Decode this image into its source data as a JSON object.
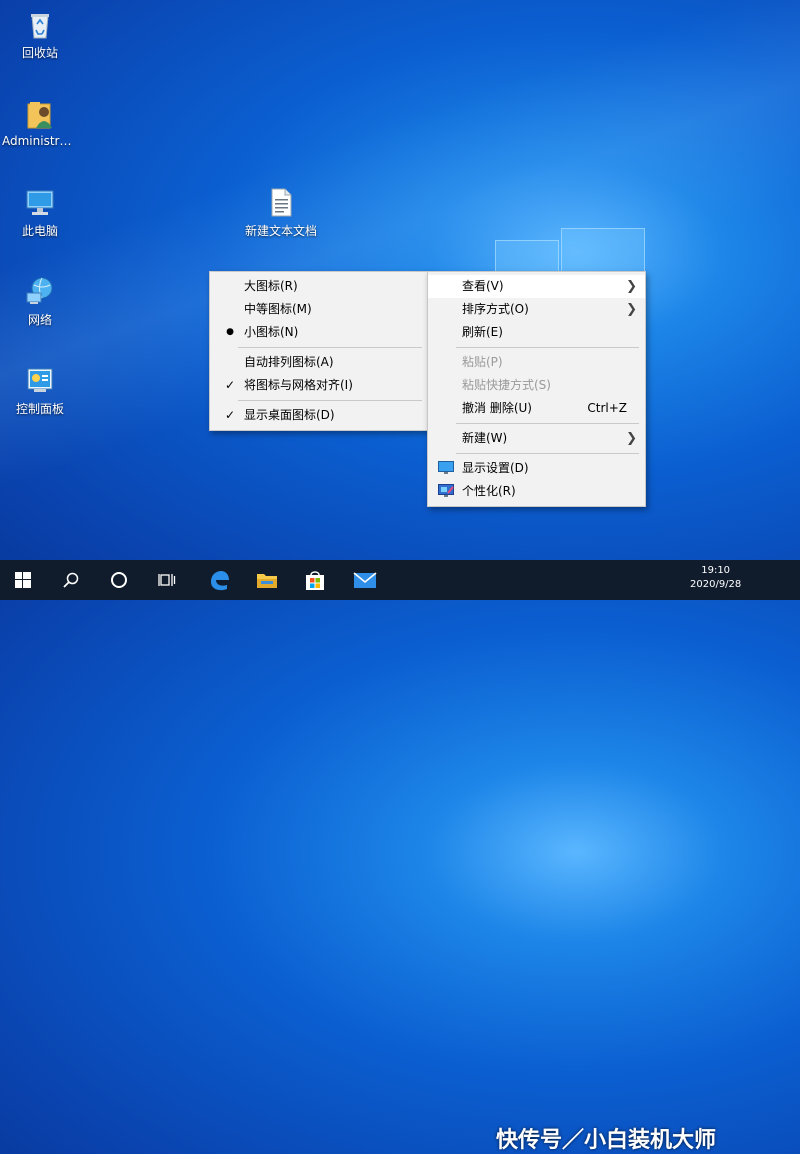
{
  "desktop": {
    "icons": [
      {
        "label": "回收站"
      },
      {
        "label": "Administra..."
      },
      {
        "label": "此电脑"
      },
      {
        "label": "网络"
      },
      {
        "label": "控制面板"
      },
      {
        "label": "新建文本文档"
      }
    ]
  },
  "context_menu": {
    "items": [
      {
        "label": "查看(V)"
      },
      {
        "label": "排序方式(O)"
      },
      {
        "label": "刷新(E)"
      },
      {
        "label": "粘贴(P)"
      },
      {
        "label": "粘贴快捷方式(S)"
      },
      {
        "label": "撤消 删除(U)",
        "shortcut": "Ctrl+Z"
      },
      {
        "label": "新建(W)"
      },
      {
        "label": "显示设置(D)"
      },
      {
        "label": "个性化(R)"
      }
    ]
  },
  "view_submenu": {
    "items": [
      {
        "label": "大图标(R)"
      },
      {
        "label": "中等图标(M)"
      },
      {
        "label": "小图标(N)",
        "mark": "●"
      },
      {
        "label": "自动排列图标(A)"
      },
      {
        "label": "将图标与网格对齐(I)",
        "mark": "✓"
      },
      {
        "label": "显示桌面图标(D)",
        "mark": "✓"
      }
    ]
  },
  "taskbar": {
    "buttons": [
      "start-icon",
      "search-icon",
      "cortana-icon",
      "task-view-icon",
      "edge-icon",
      "file-explorer-icon",
      "store-icon",
      "mail-icon"
    ],
    "watermark": "快传号／小白装机大师",
    "clock_time": "19:10",
    "clock_date": "2020/9/28"
  },
  "colors": {
    "menu_bg": "#f2f2f2",
    "menu_highlight": "#ffffff",
    "taskbar_bg": "#101c2c",
    "desktop_blue": "#0b5fd1"
  }
}
